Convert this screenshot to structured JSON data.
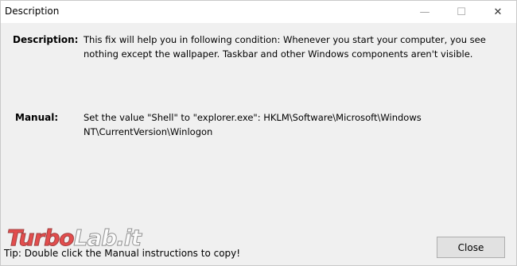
{
  "window": {
    "title": "Description"
  },
  "controls": {
    "minimize": "—",
    "maximize": "☐",
    "close": "✕"
  },
  "description": {
    "label": "Description:",
    "text": "This fix will help you in following condition: Whenever you start your computer, you see nothing except the wallpaper. Taskbar and other Windows components aren't visible."
  },
  "manual": {
    "label": "Manual:",
    "text": "Set the value \"Shell\" to \"explorer.exe\": HKLM\\Software\\Microsoft\\Windows NT\\CurrentVersion\\Winlogon"
  },
  "footer": {
    "tip": "Tip: Double click the Manual instructions to copy!",
    "close_label": "Close"
  },
  "watermark": {
    "part1": "Turbo",
    "part2": "Lab.it"
  }
}
